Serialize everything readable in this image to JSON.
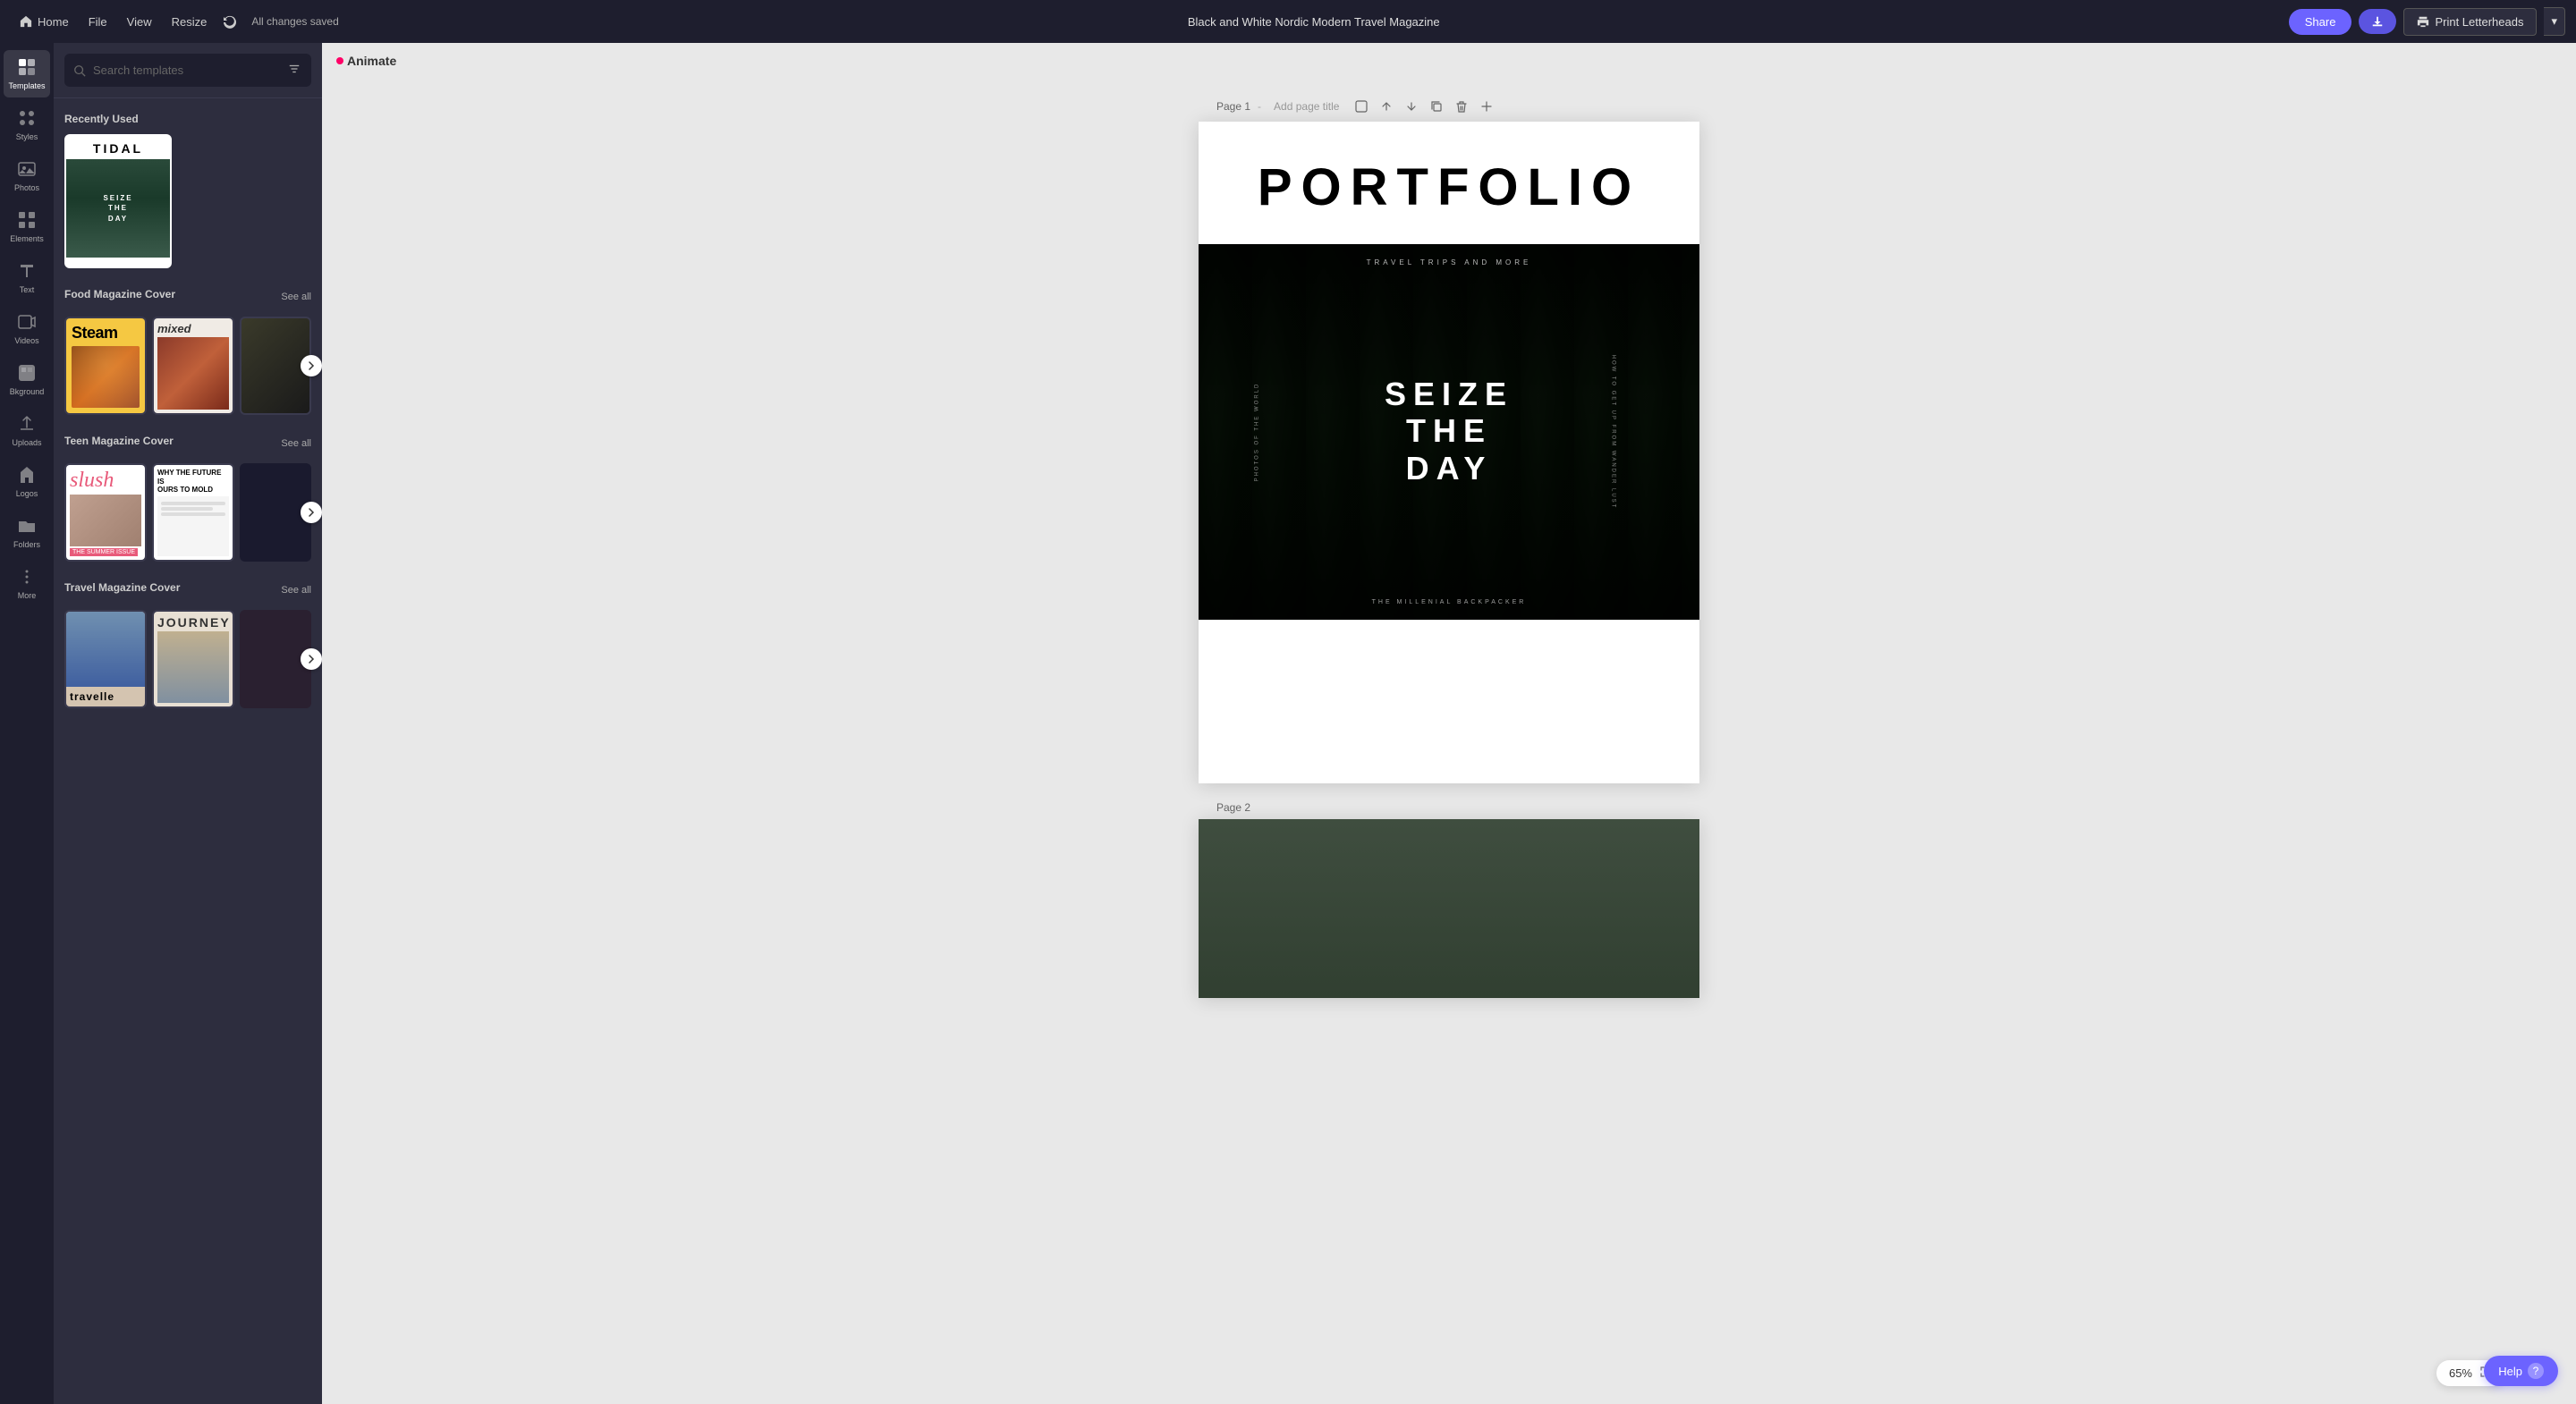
{
  "topbar": {
    "home_label": "Home",
    "file_label": "File",
    "view_label": "View",
    "resize_label": "Resize",
    "saved_text": "All changes saved",
    "title": "Black and White Nordic Modern Travel Magazine",
    "share_label": "Share",
    "download_icon": "↓",
    "print_label": "Print Letterheads",
    "print_arrow": "▾"
  },
  "sidebar": {
    "items": [
      {
        "id": "templates",
        "label": "Templates",
        "active": true
      },
      {
        "id": "styles",
        "label": "Styles",
        "active": false
      },
      {
        "id": "photos",
        "label": "Photos",
        "active": false
      },
      {
        "id": "elements",
        "label": "Elements",
        "active": false
      },
      {
        "id": "text",
        "label": "Text",
        "active": false
      },
      {
        "id": "videos",
        "label": "Videos",
        "active": false
      },
      {
        "id": "bkground",
        "label": "Bkground",
        "active": false
      },
      {
        "id": "uploads",
        "label": "Uploads",
        "active": false
      },
      {
        "id": "logos",
        "label": "Logos",
        "active": false
      },
      {
        "id": "folders",
        "label": "Folders",
        "active": false
      },
      {
        "id": "more",
        "label": "More",
        "active": false
      }
    ]
  },
  "panel": {
    "search_placeholder": "Search templates",
    "recently_used_label": "Recently Used",
    "sections": [
      {
        "id": "food",
        "label": "Food Magazine Cover",
        "see_all": "See all",
        "templates": [
          {
            "name": "Steam",
            "style": "steam"
          },
          {
            "name": "Mixed",
            "style": "mixed"
          },
          {
            "name": "Dark",
            "style": "dark"
          }
        ]
      },
      {
        "id": "teen",
        "label": "Teen Magazine Cover",
        "see_all": "See all",
        "templates": [
          {
            "name": "Slush",
            "style": "slush"
          },
          {
            "name": "Future",
            "style": "future"
          },
          {
            "name": "Dark3",
            "style": "dark3"
          }
        ]
      },
      {
        "id": "travel",
        "label": "Travel Magazine Cover",
        "see_all": "See all",
        "templates": [
          {
            "name": "Travelle",
            "style": "travelle"
          },
          {
            "name": "Journey",
            "style": "journey"
          },
          {
            "name": "Dark4",
            "style": "dark4"
          }
        ]
      }
    ]
  },
  "animate_btn": "Animate",
  "page1": {
    "label": "Page 1",
    "add_title_placeholder": "Add page title",
    "portfolio_text": "PORTFOLIO",
    "top_text": "TRAVEL TRIPS AND MORE",
    "left_text": "PHOTOS OF THE WORLD",
    "right_text": "HOW TO GET UP FROM WANDER LUST",
    "center_text_line1": "SEIZE",
    "center_text_line2": "THE",
    "center_text_line3": "DAY",
    "bottom_text": "THE MILLENIAL BACKPACKER"
  },
  "page2": {
    "label": "Page 2"
  },
  "zoom": {
    "level": "65%"
  },
  "help": {
    "label": "Help",
    "icon": "?"
  }
}
